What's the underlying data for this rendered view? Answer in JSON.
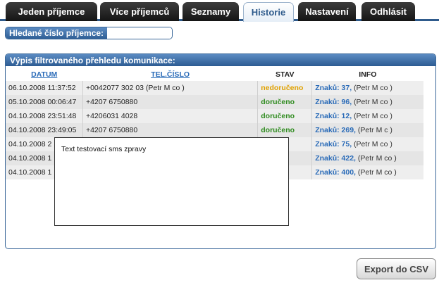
{
  "tabs": [
    {
      "label": "Jeden příjemce"
    },
    {
      "label": "Více příjemců"
    },
    {
      "label": "Seznamy"
    },
    {
      "label": "Historie"
    },
    {
      "label": "Nastavení"
    },
    {
      "label": "Odhlásit"
    }
  ],
  "search": {
    "label": "Hledané číslo příjemce:",
    "value": ""
  },
  "panel": {
    "title": "Výpis filtrovaného přehledu komunikace:"
  },
  "table": {
    "headers": {
      "date": "DATUM",
      "tel": "TEL.ČÍSLO",
      "stav": "STAV",
      "info": "INFO"
    },
    "rows": [
      {
        "date": "06.10.2008 11:37:52",
        "tel": "+0042077  302  03 (Petr M co  )",
        "stav": "nedoručeno",
        "info_link": "Znaků: 37,",
        "info_rest": " (Petr M co  )"
      },
      {
        "date": "05.10.2008 00:06:47",
        "tel": "+4207  6750880",
        "stav": "doručeno",
        "info_link": "Znaků: 96,",
        "info_rest": " (Petr M co  )"
      },
      {
        "date": "04.10.2008 23:51:48",
        "tel": "+4206031  4028",
        "stav": "doručeno",
        "info_link": "Znaků: 12,",
        "info_rest": " (Petr M co  )"
      },
      {
        "date": "04.10.2008 23:49:05",
        "tel": "+4207  6750880",
        "stav": "doručeno",
        "info_link": "Znaků: 269,",
        "info_rest": " (Petr M c  )"
      },
      {
        "date": "04.10.2008 2",
        "tel": "",
        "stav": "",
        "info_link": "Znaků: 75,",
        "info_rest": " (Petr M co  )"
      },
      {
        "date": "04.10.2008 1",
        "tel": "",
        "stav": "",
        "info_link": "Znaků: 422,",
        "info_rest": " (Petr M co  )"
      },
      {
        "date": "04.10.2008 1",
        "tel": "",
        "stav": "",
        "info_link": "Znaků: 400,",
        "info_rest": " (Petr M co  )"
      }
    ]
  },
  "popup": {
    "text": "Text testovací sms zpravy"
  },
  "export_button": {
    "label": "Export do CSV"
  },
  "colors": {
    "accent": "#2f5b8c",
    "delivered": "#2e8b1e",
    "undelivered": "#e0a100",
    "link": "#2a6bb8"
  }
}
